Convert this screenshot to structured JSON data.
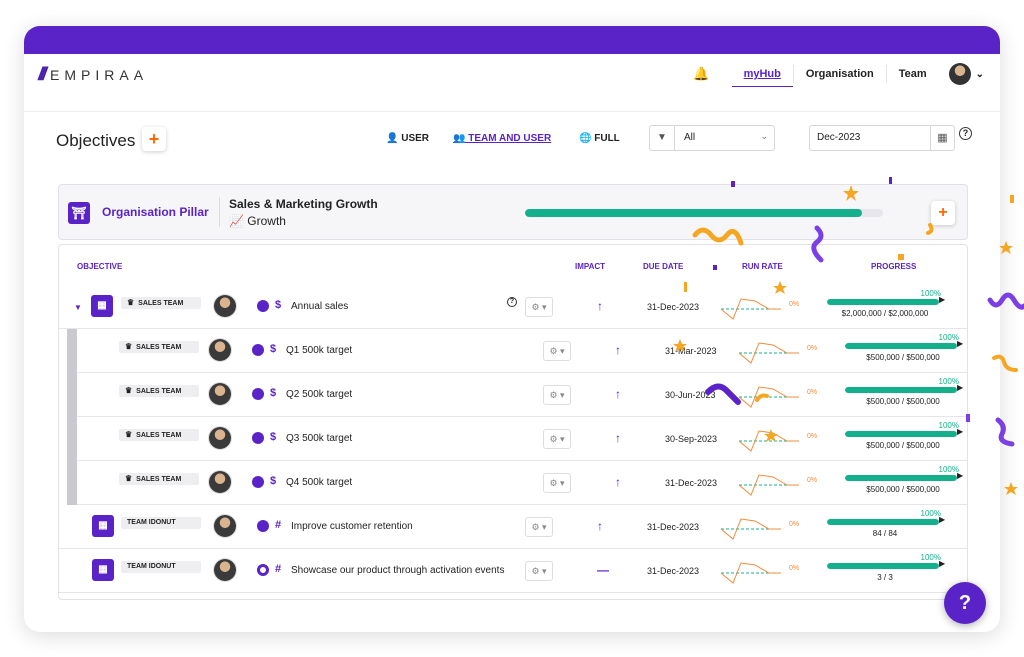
{
  "brand": {
    "name": "EMPIRAA",
    "accent": "#5a23c8",
    "orange": "#ff6a00",
    "green": "#14b08c"
  },
  "nav": {
    "links": [
      "myHub",
      "Organisation",
      "Team"
    ],
    "active": "myHub"
  },
  "toolbar": {
    "title": "Objectives",
    "add_label": "+",
    "views": [
      "USER",
      "TEAM AND USER",
      "FULL"
    ],
    "active_view": "TEAM AND USER",
    "filter_value": "All",
    "date_value": "Dec-2023",
    "help": "?"
  },
  "pillar": {
    "label": "Organisation Pillar",
    "title": "Sales & Marketing Growth",
    "subtitle": "📈 Growth",
    "progress": 0.94,
    "add_label": "+"
  },
  "table": {
    "headers": {
      "objective": "OBJECTIVE",
      "impact": "IMPACT",
      "due": "DUE DATE",
      "run": "RUN RATE",
      "progress": "PROGRESS"
    },
    "rows": [
      {
        "team": "SALES TEAM",
        "crown": true,
        "metric": "$",
        "type": "pie",
        "name": "Annual sales",
        "impact": "↑",
        "due": "31-Dec-2023",
        "run_pct": "0%",
        "pct_label": "100%",
        "pct": 1.0,
        "value": "$2,000,000 / $2,000,000"
      },
      {
        "team": "SALES TEAM",
        "crown": true,
        "metric": "$",
        "type": "pie",
        "name": "Q1 500k target",
        "impact": "↑",
        "due": "31-Mar-2023",
        "run_pct": "0%",
        "pct_label": "100%",
        "pct": 1.0,
        "value": "$500,000 / $500,000"
      },
      {
        "team": "SALES TEAM",
        "crown": true,
        "metric": "$",
        "type": "pie",
        "name": "Q2 500k target",
        "impact": "↑",
        "due": "30-Jun-2023",
        "run_pct": "0%",
        "pct_label": "100%",
        "pct": 1.0,
        "value": "$500,000 / $500,000"
      },
      {
        "team": "SALES TEAM",
        "crown": true,
        "metric": "$",
        "type": "pie",
        "name": "Q3 500k target",
        "impact": "↑",
        "due": "30-Sep-2023",
        "run_pct": "0%",
        "pct_label": "100%",
        "pct": 1.0,
        "value": "$500,000 / $500,000"
      },
      {
        "team": "SALES TEAM",
        "crown": true,
        "metric": "$",
        "type": "pie",
        "name": "Q4 500k target",
        "impact": "↑",
        "due": "31-Dec-2023",
        "run_pct": "0%",
        "pct_label": "100%",
        "pct": 1.0,
        "value": "$500,000 / $500,000"
      },
      {
        "team": "TEAM IDONUT",
        "crown": false,
        "metric": "#",
        "type": "pie",
        "name": "Improve customer retention",
        "impact": "↑",
        "due": "31-Dec-2023",
        "run_pct": "0%",
        "pct_label": "100%",
        "pct": 1.0,
        "value": "84 / 84"
      },
      {
        "team": "TEAM IDONUT",
        "crown": false,
        "metric": "#",
        "type": "goal",
        "name": "Showcase our product through activation events",
        "impact": "—",
        "due": "31-Dec-2023",
        "run_pct": "0%",
        "pct_label": "100%",
        "pct": 1.0,
        "value": "3 / 3"
      }
    ]
  },
  "help_fab": "?"
}
